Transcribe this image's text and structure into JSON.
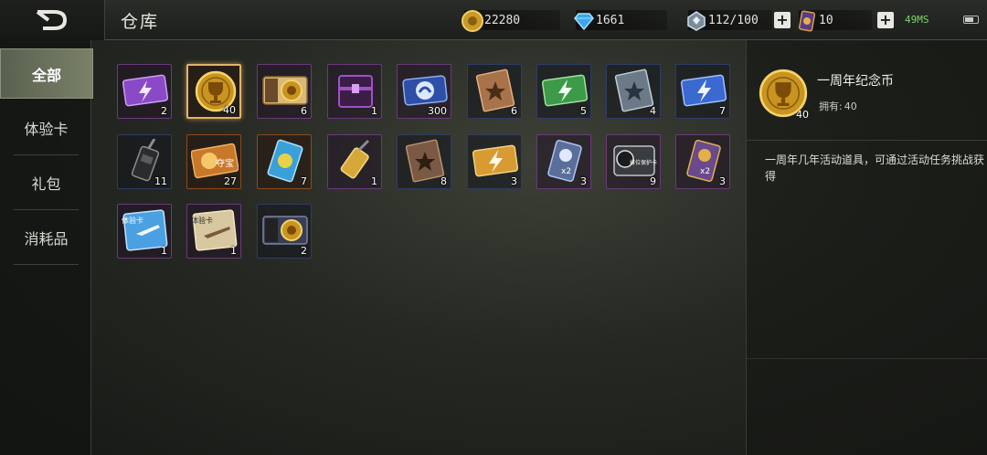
{
  "header": {
    "title": "仓库"
  },
  "resources": [
    {
      "name": "gold",
      "value": "22280",
      "icon": "gold-coin-icon"
    },
    {
      "name": "diamond",
      "value": "1661",
      "icon": "diamond-icon"
    },
    {
      "name": "energy",
      "value": "112/100",
      "icon": "crystal-icon"
    },
    {
      "name": "card",
      "value": "10",
      "icon": "card-icon"
    }
  ],
  "status": {
    "signal": "49MS"
  },
  "sidebar": {
    "items": [
      {
        "label": "全部",
        "active": true
      },
      {
        "label": "体验卡",
        "active": false
      },
      {
        "label": "礼包",
        "active": false
      },
      {
        "label": "消耗品",
        "active": false
      }
    ]
  },
  "items": [
    {
      "icon": "purple-lightning-ticket-icon",
      "qty": "2"
    },
    {
      "icon": "anniversary-coin-icon",
      "qty": "40"
    },
    {
      "icon": "contract-coin-ticket-icon",
      "qty": "6"
    },
    {
      "icon": "purple-chest-icon",
      "qty": "1"
    },
    {
      "icon": "blue-badge-ticket-icon",
      "qty": "300"
    },
    {
      "icon": "bronze-star-book-icon",
      "qty": "6"
    },
    {
      "icon": "green-lightning-ticket-icon",
      "qty": "5"
    },
    {
      "icon": "grey-star-book-icon",
      "qty": "4"
    },
    {
      "icon": "blue-lightning-ticket-icon",
      "qty": "7"
    },
    {
      "icon": "black-radio-icon",
      "qty": "11"
    },
    {
      "icon": "treasure-ticket-icon",
      "qty": "27",
      "label": "夺宝"
    },
    {
      "icon": "globe-card-icon",
      "qty": "7"
    },
    {
      "icon": "gold-radio-icon",
      "qty": "1"
    },
    {
      "icon": "brown-star-book-icon",
      "qty": "8"
    },
    {
      "icon": "gold-lightning-ticket-icon",
      "qty": "3"
    },
    {
      "icon": "double-exp-card-icon",
      "qty": "3",
      "label": "x2"
    },
    {
      "icon": "rank-protect-card-icon",
      "qty": "9",
      "label": "排位保护卡"
    },
    {
      "icon": "double-gold-card-icon",
      "qty": "3",
      "label": "x2"
    },
    {
      "icon": "plane-trial-card-icon",
      "qty": "1",
      "label": "体验卡"
    },
    {
      "icon": "rifle-trial-card-icon",
      "qty": "1",
      "label": "体验卡"
    },
    {
      "icon": "contract-coin-ticket-icon",
      "qty": "2"
    }
  ],
  "detail": {
    "name": "一周年纪念币",
    "qty": "40",
    "own_label": "拥有:",
    "own_value": "40",
    "description": "一周年几年活动道具，可通过活动任务挑战获得"
  },
  "colors": {
    "accent": "#e2b36a",
    "active_tab": "#6d745e",
    "signal": "#7fd46a"
  }
}
